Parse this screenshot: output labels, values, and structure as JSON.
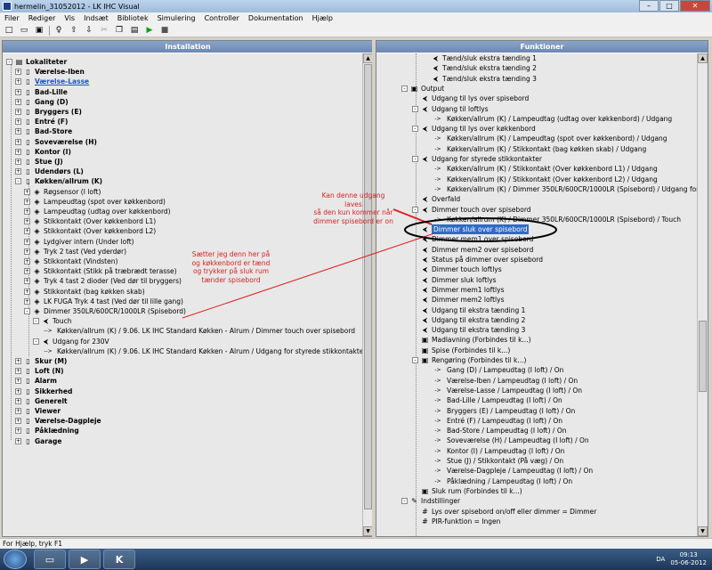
{
  "window": {
    "title": "hermelin_31052012 - LK IHC Visual",
    "minimize": "–",
    "maximize": "□",
    "close": "✕"
  },
  "menu": [
    "Filer",
    "Rediger",
    "Vis",
    "Indsæt",
    "Bibliotek",
    "Simulering",
    "Controller",
    "Dokumentation",
    "Hjælp"
  ],
  "toolbar_icons": [
    "new-icon",
    "open-icon",
    "save-icon",
    "pin-icon",
    "upload-icon",
    "download-icon",
    "cut-icon",
    "copy-icon",
    "paste-icon",
    "play-icon",
    "stop-icon"
  ],
  "left_pane": {
    "header": "Installation",
    "rows": [
      {
        "t": "Lokaliteter",
        "b": 1,
        "i": "folder"
      },
      {
        "t": "Værelse-Iben",
        "b": 1
      },
      {
        "t": "Værelse-Lasse",
        "b": 1,
        "l": 1
      },
      {
        "t": "Bad-Lille",
        "b": 1
      },
      {
        "t": "Gang (D)",
        "b": 1
      },
      {
        "t": "Bryggers (E)",
        "b": 1
      },
      {
        "t": "Entré (F)",
        "b": 1
      },
      {
        "t": "Bad-Store",
        "b": 1
      },
      {
        "t": "Soveværelse (H)",
        "b": 1
      },
      {
        "t": "Kontor (I)",
        "b": 1
      },
      {
        "t": "Stue (J)",
        "b": 1
      },
      {
        "t": "Udendørs (L)",
        "b": 1
      },
      {
        "t": "Køkken/allrum (K)",
        "b": 1
      },
      {
        "t": "Røgsensor (I loft)"
      },
      {
        "t": "Lampeudtag (spot over køkkenbord)"
      },
      {
        "t": "Lampeudtag (udtag over køkkenbord)"
      },
      {
        "t": "Stikkontakt (Over køkkenbord L1)"
      },
      {
        "t": "Stikkontakt (Over køkkenbord L2)"
      },
      {
        "t": "Lydgiver intern (Under loft)"
      },
      {
        "t": "Tryk 2 tast (Ved yderdør)"
      },
      {
        "t": "Stikkontakt (Vindsten)"
      },
      {
        "t": "Stikkontakt (Stikk på træbrædt terasse)"
      },
      {
        "t": "Tryk 4 tast 2 dioder (Ved dør til bryggers)"
      },
      {
        "t": "Stikkontakt (bag køkken skab)"
      },
      {
        "t": "LK FUGA Tryk 4 tast (Ved dør til lille gang)"
      },
      {
        "t": "Dimmer 350LR/600CR/1000LR (Spisebord)"
      },
      {
        "t": "Touch"
      },
      {
        "t": "Køkken/allrum (K) / 9.06. LK IHC Standard Køkken - Alrum / Dimmer touch over spisebord"
      },
      {
        "t": "Udgang for 230V"
      },
      {
        "t": "Køkken/allrum (K) / 9.06. LK IHC Standard Køkken - Alrum / Udgang for styrede stikkontakter"
      },
      {
        "t": "Skur (M)",
        "b": 1
      },
      {
        "t": "Loft (N)",
        "b": 1
      },
      {
        "t": "Alarm",
        "b": 1
      },
      {
        "t": "Sikkerhed",
        "b": 1
      },
      {
        "t": "Generelt",
        "b": 1
      },
      {
        "t": "Viewer",
        "b": 1
      },
      {
        "t": "Værelse-Dagpleje",
        "b": 1
      },
      {
        "t": "Påklædning",
        "b": 1
      },
      {
        "t": "Garage",
        "b": 1
      }
    ]
  },
  "right_pane": {
    "header": "Funktioner",
    "rows": [
      "Tænd/sluk ekstra tænding 1",
      "Tænd/sluk ekstra tænding 2",
      "Tænd/sluk ekstra tænding 3",
      "Output",
      "Udgang til lys over spisebord",
      "Udgang til loftlys",
      "Køkken/allrum (K) / Lampeudtag (udtag over køkkenbord)  / Udgang",
      "Udgang til lys over køkkenbord",
      "Køkken/allrum (K) / Lampeudtag (spot over køkkenbord)  / Udgang",
      "Køkken/allrum (K) / Stikkontakt (bag køkken skab)  / Udgang",
      "Udgang for styrede stikkontakter",
      "Køkken/allrum (K) / Stikkontakt (Over køkkenbord L1)  / Udgang",
      "Køkken/allrum (K) / Stikkontakt (Over køkkenbord L2)  / Udgang",
      "Køkken/allrum (K) / Dimmer 350LR/600CR/1000LR (Spisebord)  / Udgang for 230V",
      "Overfald",
      "Dimmer touch over spisebord",
      "Køkken/allrum (K) / Dimmer 350LR/600CR/1000LR (Spisebord)  / Touch",
      "Dimmer sluk over spisebord",
      "Dimmer mem1 over spisebord",
      "Dimmer mem2 over spisebord",
      "Status på dimmer over spisebord",
      "Dimmer touch loftlys",
      "Dimmer sluk loftlys",
      "Dimmer mem1 loftlys",
      "Dimmer mem2 loftlys",
      "Udgang til ekstra tænding 1",
      "Udgang til ekstra tænding 2",
      "Udgang til ekstra tænding 3",
      "Madlavning (Forbindes til k...)",
      "Spise (Forbindes til k...)",
      "Rengøring (Forbindes til k...)",
      "Gang (D) / Lampeudtag (I loft)  / On",
      "Værelse-Iben / Lampeudtag (I loft)  / On",
      "Værelse-Lasse / Lampeudtag (I loft)  / On",
      "Bad-Lille / Lampeudtag (I loft)  / On",
      "Bryggers (E) / Lampeudtag (I loft)  / On",
      "Entré (F) / Lampeudtag (I loft)  / On",
      "Bad-Store / Lampeudtag (I loft)  / On",
      "Soveværelse (H) / Lampeudtag (I loft)  / On",
      "Kontor (I) / Lampeudtag (I loft)  / On",
      "Stue (J) / Stikkontakt (På væg)  / On",
      "Værelse-Dagpleje / Lampeudtag (I loft)  / On",
      "Påklædning / Lampeudtag (I loft)  / On",
      "Sluk rum (Forbindes til k...)",
      "Indstillinger",
      "Lys over spisebord on/off eller dimmer = Dimmer",
      "PIR-funktion = Ingen"
    ]
  },
  "annotations": {
    "a1": [
      "Kan denne udgang laves",
      "så den kun kommer når",
      "dimmer spisebord er on"
    ],
    "a2": [
      "Sætter jeg denn her på",
      "og køkkenbord er tænd",
      "og trykker på sluk rum",
      "tænder spisebord"
    ]
  },
  "statusbar": "For Hjælp, tryk F1",
  "taskbar": {
    "lang": "DA",
    "time": "09:13",
    "date": "05-06-2012"
  }
}
